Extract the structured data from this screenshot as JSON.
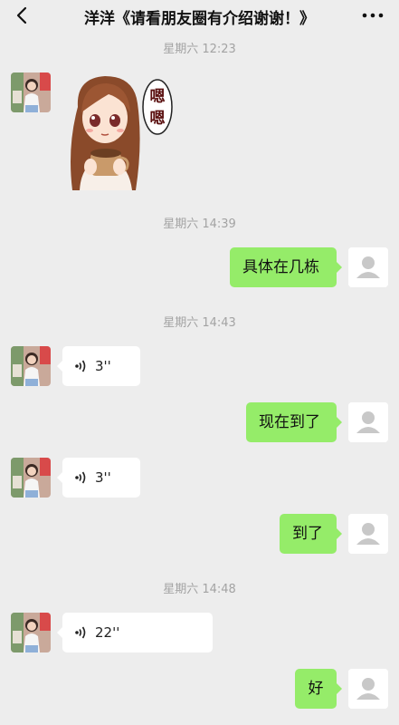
{
  "nav": {
    "title": "洋洋《请看朋友圈有介绍谢谢！》",
    "back_icon": "chevron-left-icon",
    "more_icon": "more-dots-icon"
  },
  "timestamps": {
    "t1": "星期六 12:23",
    "t2": "星期六 14:39",
    "t3": "星期六 14:43",
    "t4": "星期六 14:48"
  },
  "sticker": {
    "text": "嗯嗯"
  },
  "messages": {
    "m1": "具体在几栋",
    "v1": "3''",
    "m2": "现在到了",
    "v2": "3''",
    "m3": "到了",
    "v3": "22''",
    "m4": "好"
  },
  "colors": {
    "background": "#ededed",
    "outgoing_bubble": "#95ec69",
    "incoming_bubble": "#ffffff",
    "timestamp_text": "#a3a3a3"
  }
}
